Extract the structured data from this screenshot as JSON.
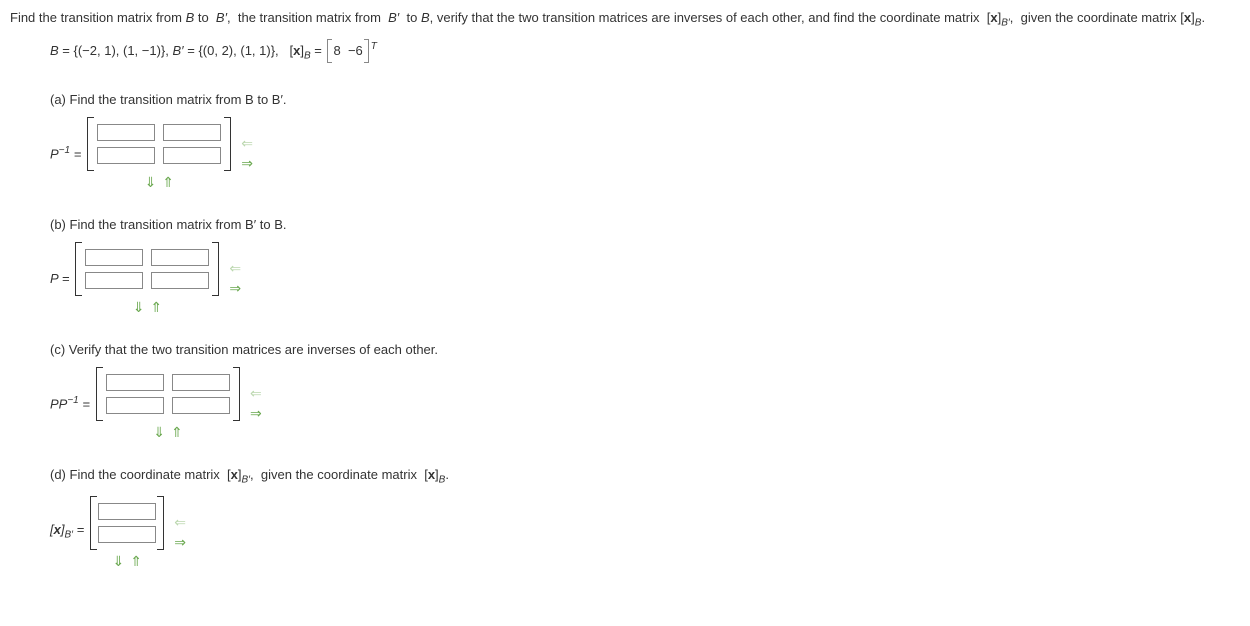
{
  "intro": "Find the transition matrix from B to  B′,  the transition matrix from  B′  to B, verify that the two transition matrices are inverses of each other, and find the coordinate matrix  [x]B′,  given the coordinate matrix [x]B.",
  "given": {
    "B_label": "B",
    "B_set": "= {(−2, 1), (1, −1)},",
    "Bprime_label": "B′",
    "Bprime_set": "= {(0, 2), (1, 1)},",
    "xB_lhs": "[x]B =",
    "xB_values": [
      "8",
      "−6"
    ],
    "transpose": "T"
  },
  "parts": {
    "a": {
      "label": "(a) Find the transition matrix from B to  B′.",
      "lhs": "P⁻¹ ="
    },
    "b": {
      "label": "(b) Find the transition matrix from  B′  to B.",
      "lhs": "P ="
    },
    "c": {
      "label": "(c) Verify that the two transition matrices are inverses of each other.",
      "lhs": "PP⁻¹ ="
    },
    "d": {
      "label": "(d) Find the coordinate matrix  [x]B′,  given the coordinate matrix  [x]B.",
      "lhs": "[x]B′ ="
    }
  },
  "arrows": {
    "left": "⇐",
    "right": "⇒",
    "down": "⇓",
    "up": "⇑"
  }
}
